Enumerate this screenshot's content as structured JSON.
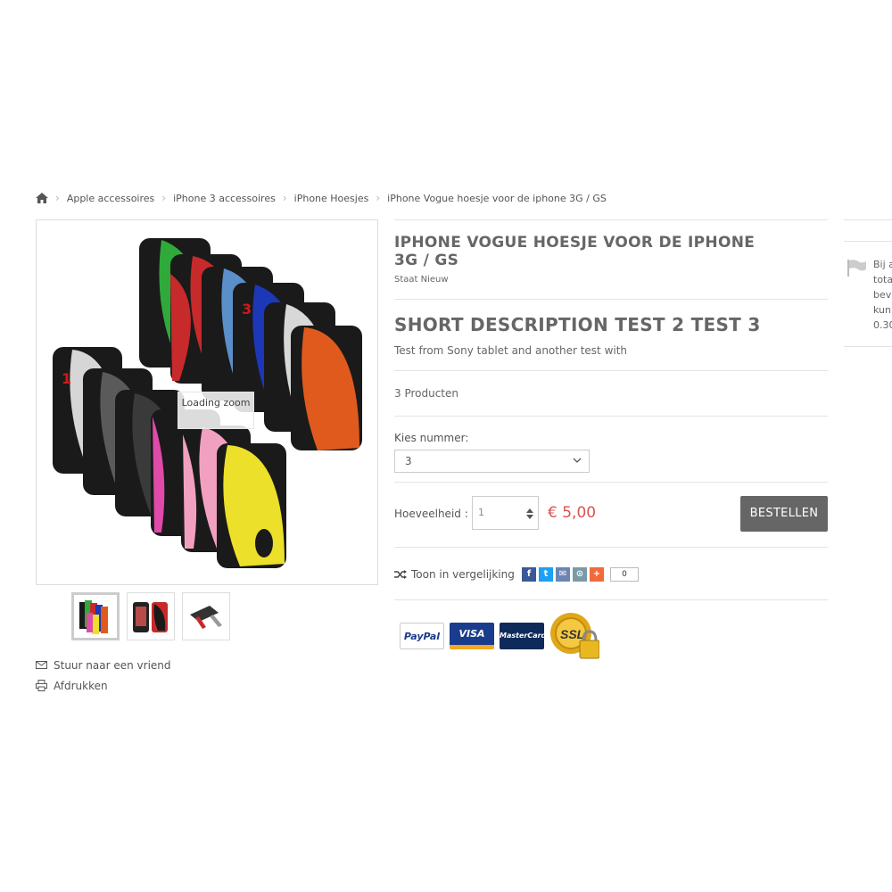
{
  "breadcrumb": {
    "items": [
      "Apple accessoires",
      "iPhone 3 accessoires",
      "iPhone Hoesjes",
      "iPhone Vogue hoesje voor de iphone 3G / GS"
    ]
  },
  "gallery": {
    "loading_text": "Loading zoom",
    "thumbnail_count": 3
  },
  "side_links": {
    "send_friend": "Stuur naar een vriend",
    "print": "Afdrukken"
  },
  "product": {
    "title": "IPHONE VOGUE HOESJE VOOR DE IPHONE 3G / GS",
    "condition": "Staat Nieuw",
    "short_description_title": "SHORT DESCRIPTION TEST 2 TEST 3",
    "short_description_text": "Test from Sony tablet and another test with",
    "stock": "3 Producten",
    "option_label": "Kies nummer:",
    "option_value": "3",
    "quantity_label": "Hoeveelheid :",
    "quantity_value": "1",
    "price": "€ 5,00",
    "buy_label": "BESTELLEN",
    "compare_label": "Toon in vergelijking",
    "share_count": "0"
  },
  "payments": [
    "PayPal",
    "VISA",
    "MasterCard",
    "SSL"
  ],
  "sidebar": {
    "text_lines": [
      "Bij a",
      "tota",
      "bev",
      "kun",
      "0.30"
    ]
  },
  "colors": {
    "price": "#d9534f",
    "button": "#666666",
    "facebook": "#3b5998",
    "twitter": "#1da1f2"
  }
}
